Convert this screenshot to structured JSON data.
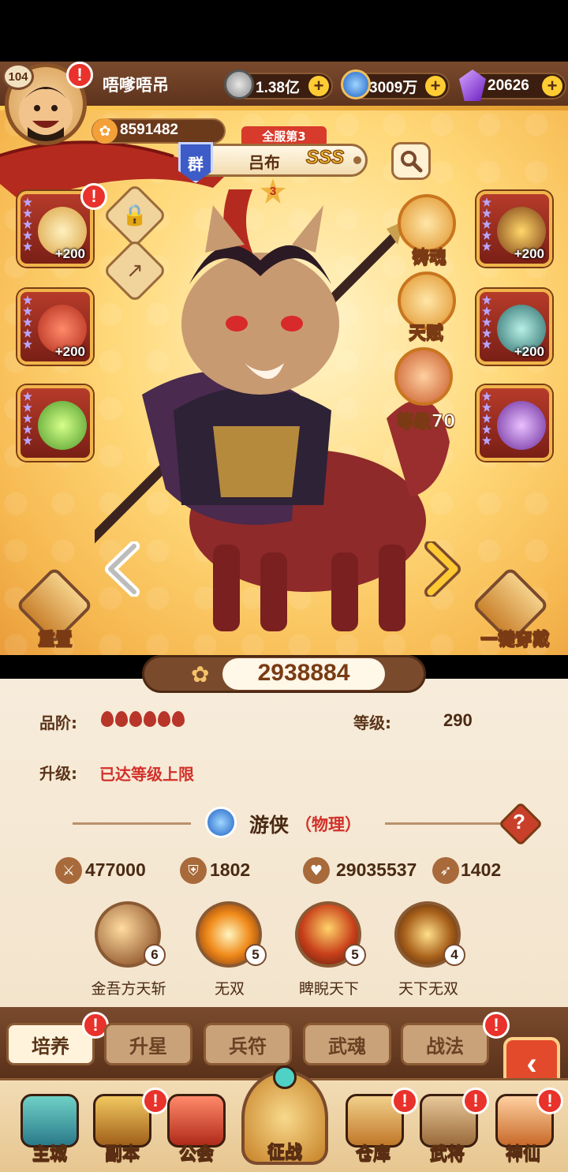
{
  "player": {
    "level": "104",
    "name": "唔嗲唔吊",
    "power": "8591482"
  },
  "resources": {
    "coins": "1.38亿",
    "gems": "3009万",
    "crystals": "20626"
  },
  "hero": {
    "rank_tag": "全服第3",
    "faction": "群",
    "name": "吕布",
    "grade": "SSS",
    "stars": "3",
    "power": "2938884"
  },
  "slots": {
    "left": [
      {
        "bonus": "+200"
      },
      {
        "bonus": "+200"
      },
      {
        "bonus": ""
      }
    ],
    "right": [
      {
        "bonus": "+200"
      },
      {
        "bonus": "+200"
      },
      {
        "bonus": ""
      }
    ]
  },
  "features": {
    "forge_soul": "铸魂",
    "talent": "天赋",
    "level": "等级70"
  },
  "actions": {
    "reset": "重置",
    "equip_all": "一键穿戴"
  },
  "info": {
    "quality_label": "品阶:",
    "level_label": "等级:",
    "level_value": "290",
    "upgrade_label": "升级:",
    "upgrade_value": "已达等级上限",
    "class_name": "游侠",
    "class_type": "（物理）"
  },
  "stats": {
    "attack": "477000",
    "defense": "1802",
    "hp": "29035537",
    "speed": "1402"
  },
  "skills": [
    {
      "name": "金吾方天斩",
      "level": "6"
    },
    {
      "name": "无双",
      "level": "5"
    },
    {
      "name": "睥睨天下",
      "level": "5"
    },
    {
      "name": "天下无双",
      "level": "4"
    }
  ],
  "tabs": [
    "培养",
    "升星",
    "兵符",
    "武魂",
    "战法"
  ],
  "nav": {
    "main_city": "主城",
    "dungeon": "副本",
    "guild": "公会",
    "battle": "征战",
    "warehouse": "仓库",
    "generals": "武将",
    "immortals": "神仙"
  },
  "colors": {
    "header": "#6b3a1b",
    "accent": "#f0b54a",
    "alert": "#e8322b",
    "panel": "#f7ecdb"
  }
}
